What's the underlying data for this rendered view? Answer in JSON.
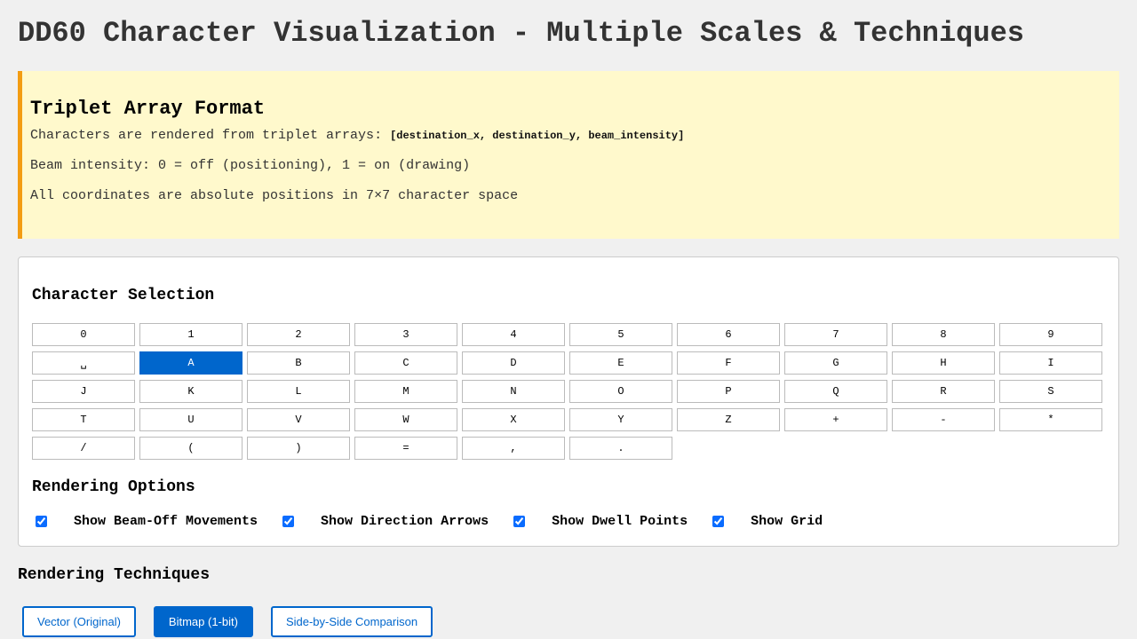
{
  "page": {
    "title": "DD60 Character Visualization - Multiple Scales & Techniques"
  },
  "info": {
    "heading": "Triplet Array Format",
    "line1_prefix": "Characters are rendered from triplet arrays: ",
    "line1_code": "[destination_x, destination_y, beam_intensity]",
    "line2": "Beam intensity: 0 = off (positioning), 1 = on (drawing)",
    "line3": "All coordinates are absolute positions in 7×7 character space"
  },
  "selection": {
    "heading": "Character Selection",
    "selected": "A",
    "characters": [
      "0",
      "1",
      "2",
      "3",
      "4",
      "5",
      "6",
      "7",
      "8",
      "9",
      "␣",
      "A",
      "B",
      "C",
      "D",
      "E",
      "F",
      "G",
      "H",
      "I",
      "J",
      "K",
      "L",
      "M",
      "N",
      "O",
      "P",
      "Q",
      "R",
      "S",
      "T",
      "U",
      "V",
      "W",
      "X",
      "Y",
      "Z",
      "+",
      "-",
      "*",
      "/",
      "(",
      ")",
      "=",
      ",",
      "."
    ]
  },
  "options": {
    "heading": "Rendering Options",
    "items": [
      {
        "label": "Show Beam-Off Movements",
        "checked": true
      },
      {
        "label": "Show Direction Arrows",
        "checked": true
      },
      {
        "label": "Show Dwell Points",
        "checked": true
      },
      {
        "label": "Show Grid",
        "checked": true
      }
    ]
  },
  "techniques": {
    "heading": "Rendering Techniques",
    "active": "Bitmap (1-bit)",
    "buttons": [
      "Vector (Original)",
      "Bitmap (1-bit)",
      "Side-by-Side Comparison"
    ]
  },
  "colors": {
    "accent": "#0066cc",
    "info_background": "#fff9cc",
    "info_border": "#f39c12"
  }
}
